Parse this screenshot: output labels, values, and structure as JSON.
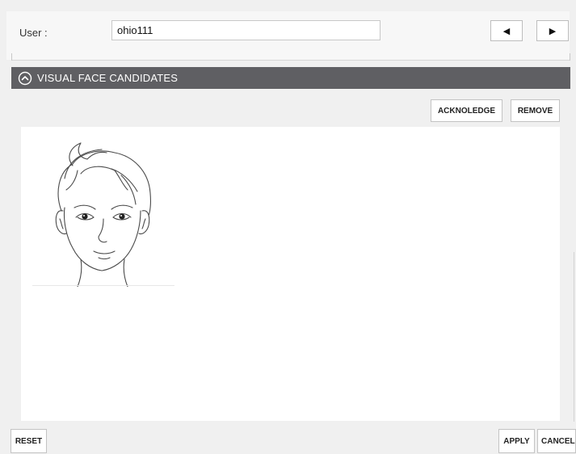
{
  "user": {
    "label": "User :",
    "value": "ohio111"
  },
  "nav": {
    "prev_icon": "triangle-left-icon",
    "next_icon": "triangle-right-icon"
  },
  "section": {
    "title": "VISUAL FACE CANDIDATES",
    "icon": "chevron-up-circle-icon",
    "header_color": "#5f5f63"
  },
  "actions": {
    "acknowledge_label": "ACKNOLEDGE",
    "remove_label": "REMOVE"
  },
  "face_candidates": [
    {
      "image": "male-face-line-drawing"
    }
  ],
  "footer": {
    "reset_label": "RESET",
    "apply_label": "APPLY",
    "cancel_label": "CANCEL"
  }
}
